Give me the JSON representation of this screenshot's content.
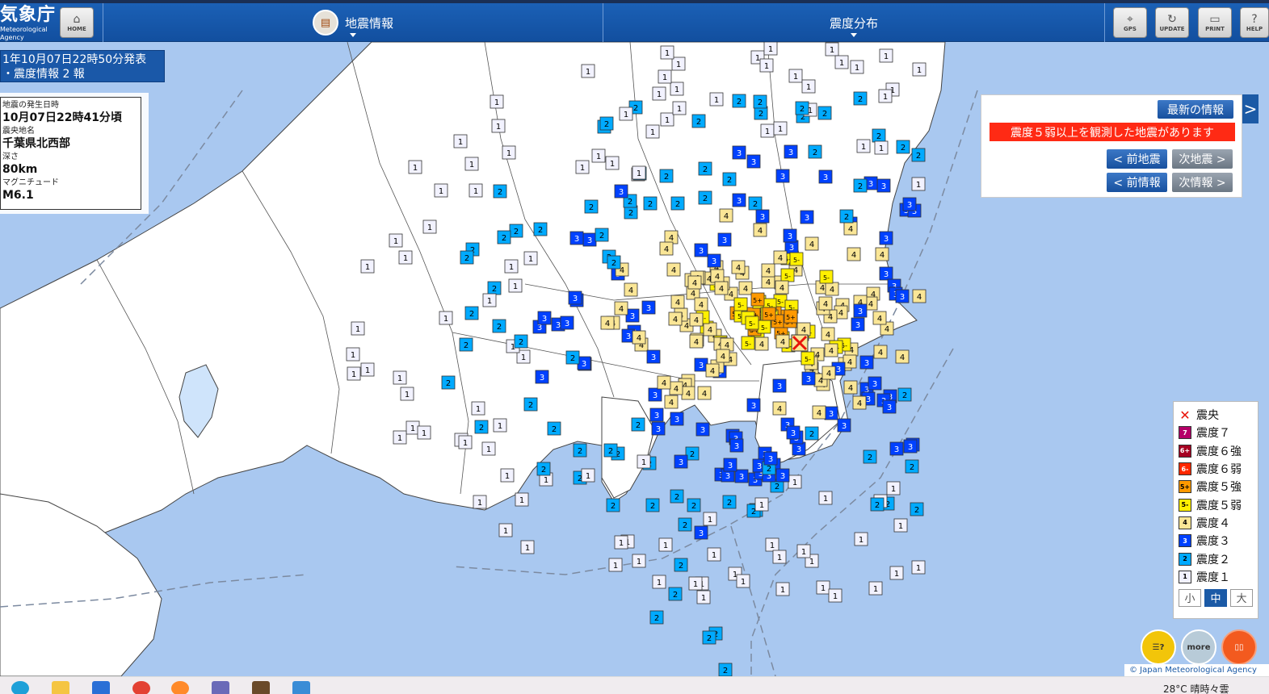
{
  "header": {
    "logo_main": "気象庁",
    "logo_sub": "Meteorological Agency",
    "home_label": "HOME",
    "tab_quake_info": "地震情報",
    "tab_distribution": "震度分布",
    "gps_label": "GPS",
    "update_label": "UPDATE",
    "print_label": "PRINT",
    "help_label": "HELP"
  },
  "issue": {
    "line1": "1年10月07日22時50分発表",
    "line2": "・震度情報 2 報"
  },
  "quake": {
    "time_label": "地震の発生日時",
    "time_value": "10月07日22時41分頃",
    "place_label": "震央地名",
    "place_value": "千葉県北西部",
    "depth_label": "深さ",
    "depth_value": "80km",
    "mag_label": "マグニチュード",
    "mag_value": "M6.1"
  },
  "nav": {
    "latest": "最新の情報",
    "alert": "震度５弱以上を観測した地震があります",
    "prev_quake": "< 前地震",
    "next_quake": "次地震 >",
    "prev_report": "< 前情報",
    "next_report": "次情報 >",
    "side_arrow": ">"
  },
  "legend": {
    "items": [
      {
        "label": "震央",
        "code": "✕",
        "color": "#ffffff",
        "text": "#e8140a"
      },
      {
        "label": "震度７",
        "code": "7",
        "color": "#b40068",
        "text": "#ffffff"
      },
      {
        "label": "震度６強",
        "code": "6+",
        "color": "#a50021",
        "text": "#ffffff"
      },
      {
        "label": "震度６弱",
        "code": "6-",
        "color": "#ff2800",
        "text": "#ffffff"
      },
      {
        "label": "震度５強",
        "code": "5+",
        "color": "#ff9900",
        "text": "#000000"
      },
      {
        "label": "震度５弱",
        "code": "5-",
        "color": "#fff000",
        "text": "#000000"
      },
      {
        "label": "震度４",
        "code": "4",
        "color": "#fae696",
        "text": "#000000"
      },
      {
        "label": "震度３",
        "code": "3",
        "color": "#0041ff",
        "text": "#ffffff"
      },
      {
        "label": "震度２",
        "code": "2",
        "color": "#00aaff",
        "text": "#000000"
      },
      {
        "label": "震度１",
        "code": "1",
        "color": "#f2f2ff",
        "text": "#000000"
      }
    ],
    "size_small": "小",
    "size_medium": "中",
    "size_large": "大"
  },
  "buttons": {
    "more": "more"
  },
  "copyright": "© Japan Meteorological Agency",
  "taskbar": {
    "weather": "28°C  晴時々雲"
  }
}
